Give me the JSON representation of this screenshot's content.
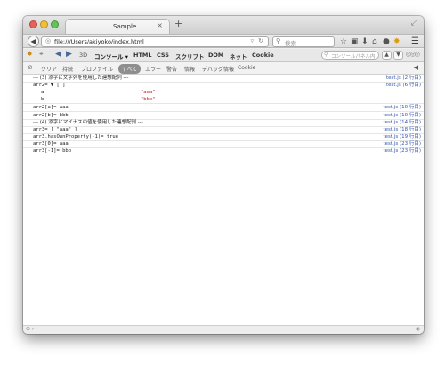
{
  "tab": {
    "title": "Sample",
    "close": "×",
    "new_tab": "+"
  },
  "navbar": {
    "back": "◀",
    "url": "file:///Users/akiyoko/index.html",
    "search_placeholder": "検索"
  },
  "devtools": {
    "tabs": [
      {
        "label": "3D"
      },
      {
        "label": "コンソール ▾"
      },
      {
        "label": "HTML"
      },
      {
        "label": "CSS"
      },
      {
        "label": "スクリプト"
      },
      {
        "label": "DOM"
      },
      {
        "label": "ネット"
      },
      {
        "label": "Cookie"
      }
    ],
    "filter_placeholder": "コンソールパネル内",
    "up": "▲",
    "down": "▼"
  },
  "filters": {
    "items": [
      {
        "label": "クリア"
      },
      {
        "label": "持続"
      },
      {
        "label": "プロファイル"
      },
      {
        "label": "すべて"
      },
      {
        "label": "エラー"
      },
      {
        "label": "警告"
      },
      {
        "label": "情報"
      },
      {
        "label": "デバッグ情報"
      },
      {
        "label": "Cookie"
      }
    ]
  },
  "console": {
    "rows": [
      {
        "text": "--- (3) 添字に文字列を使用した連想配列 ---",
        "src": "test.js (2 行目)"
      },
      {
        "text": "arr2= ▼ [ ]",
        "src": "test.js (6 行目)"
      },
      {
        "key": "a",
        "value": "\"aaa\""
      },
      {
        "key": "b",
        "value": "\"bbb\""
      },
      {
        "text": "arr2[a]= aaa",
        "src": "test.js (10 行目)"
      },
      {
        "text": "arr2[b]= bbb",
        "src": "test.js (10 行目)"
      },
      {
        "text": "--- (4) 添字にマイナスの値を使用した連想配列 ---",
        "src": "test.js (14 行目)"
      },
      {
        "text": "arr3= [ \"aaa\" ]",
        "src": "test.js (18 行目)"
      },
      {
        "text": "arr3.hasOwnProperty(-1)= true",
        "src": "test.js (19 行目)"
      },
      {
        "text": "arr3[0]= aaa",
        "src": "test.js (23 行目)"
      },
      {
        "text": "arr3[-1]= bbb",
        "src": "test.js (23 行目)"
      }
    ]
  }
}
